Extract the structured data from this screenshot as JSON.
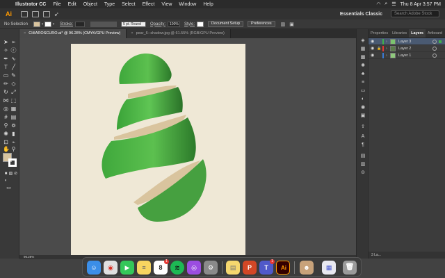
{
  "menubar": {
    "app_name": "Illustrator CC",
    "items": [
      "File",
      "Edit",
      "Object",
      "Type",
      "Select",
      "Effect",
      "View",
      "Window",
      "Help"
    ],
    "clock": "Thu 8 Apr  3:57 PM"
  },
  "appbar": {
    "logo": "Ai",
    "workspace": "Essentials Classic",
    "search_placeholder": "Search Adobe Stock"
  },
  "control": {
    "selection": "No Selection",
    "fill_color": "#d9c49e",
    "stroke_label": "Stroke:",
    "brush": "5 pt. Round",
    "opacity_label": "Opacity:",
    "opacity_value": "100%",
    "style_label": "Style:",
    "doc_setup": "Document Setup",
    "preferences": "Preferences"
  },
  "tabs": [
    {
      "label": "CHIAROSCURO.ai* @ 96.28% (CMYK/GPU Preview)",
      "active": true
    },
    {
      "label": "pear_6--shadow.jpg @ 61.55% (RGB/GPU Preview)",
      "active": false
    }
  ],
  "right_panel": {
    "tabs": [
      "Properties",
      "Libraries",
      "Layers",
      "Artboard"
    ],
    "active_tab": "Layers",
    "layers": [
      {
        "name": "Layer 3",
        "color": "#3fb24b",
        "selected": true,
        "locked": false
      },
      {
        "name": "Layer 2",
        "color": "#e53935",
        "selected": false,
        "locked": true
      },
      {
        "name": "Layer 1",
        "color": "#3a7bd5",
        "selected": false,
        "locked": false
      }
    ],
    "footer": "3 La..."
  },
  "status": {
    "zoom": "96.28%"
  },
  "canvas": {
    "artboard_color": "#efe8d6",
    "accent_green": "#4caf45",
    "dark_green": "#2e7d32",
    "shadow_tan": "#d9c49e"
  },
  "dock": {
    "apps": [
      {
        "name": "finder",
        "glyph": "☺",
        "color": "#3b8ee8",
        "badge": ""
      },
      {
        "name": "chrome",
        "glyph": "◉",
        "color": "#e0e0e0",
        "badge": ""
      },
      {
        "name": "facetime",
        "glyph": "▶",
        "color": "#34c759",
        "badge": ""
      },
      {
        "name": "notes",
        "glyph": "≡",
        "color": "#f7d560",
        "badge": ""
      },
      {
        "name": "calendar",
        "glyph": "8",
        "color": "#ffffff",
        "badge": "1"
      },
      {
        "name": "spotify",
        "glyph": "≋",
        "color": "#1db954",
        "badge": ""
      },
      {
        "name": "podcasts",
        "glyph": "◎",
        "color": "#9b4de0",
        "badge": ""
      },
      {
        "name": "system-preferences",
        "glyph": "⚙",
        "color": "#8a8a8a",
        "badge": ""
      },
      {
        "name": "stickies",
        "glyph": "▤",
        "color": "#f5d76e",
        "badge": ""
      },
      {
        "name": "powerpoint",
        "glyph": "P",
        "color": "#d24726",
        "badge": ""
      },
      {
        "name": "teams",
        "glyph": "T",
        "color": "#5059c9",
        "badge": "1"
      },
      {
        "name": "illustrator",
        "glyph": "Ai",
        "color": "#330000",
        "badge": ""
      },
      {
        "name": "photo-preview",
        "glyph": "☻",
        "color": "#c8a27a",
        "badge": ""
      },
      {
        "name": "downloads-stack",
        "glyph": "▦",
        "color": "#e8e8f0",
        "badge": ""
      },
      {
        "name": "trash",
        "glyph": "🗑",
        "color": "#9a9a9a",
        "badge": ""
      }
    ]
  }
}
